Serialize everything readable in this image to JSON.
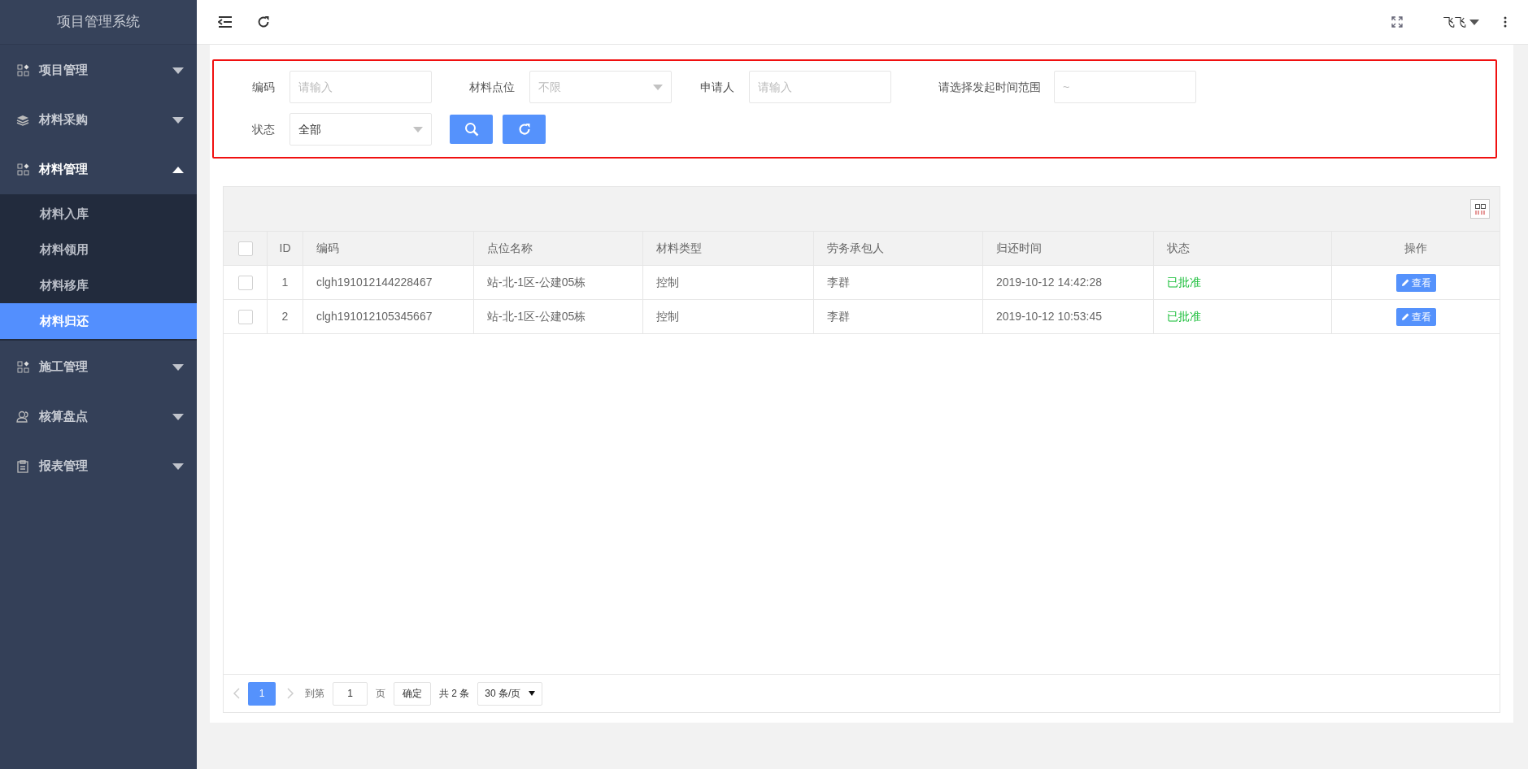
{
  "app_title": "项目管理系统",
  "sidebar": {
    "items": [
      {
        "label": "项目管理",
        "expanded": false
      },
      {
        "label": "材料采购",
        "expanded": false
      },
      {
        "label": "材料管理",
        "expanded": true,
        "children": [
          {
            "label": "材料入库",
            "selected": false
          },
          {
            "label": "材料领用",
            "selected": false
          },
          {
            "label": "材料移库",
            "selected": false
          },
          {
            "label": "材料归还",
            "selected": true
          }
        ]
      },
      {
        "label": "施工管理",
        "expanded": false
      },
      {
        "label": "核算盘点",
        "expanded": false
      },
      {
        "label": "报表管理",
        "expanded": false
      }
    ]
  },
  "user": {
    "name": "飞飞"
  },
  "filters": [
    {
      "kind": "input",
      "label": "编码",
      "placeholder": "请输入"
    },
    {
      "kind": "select",
      "label": "材料点位",
      "placeholder": "不限"
    },
    {
      "kind": "input",
      "label": "申请人",
      "placeholder": "请输入"
    },
    {
      "kind": "input",
      "label": "请选择发起时间范围",
      "placeholder": "~"
    },
    {
      "kind": "select",
      "label": "状态",
      "value": "全部"
    }
  ],
  "table": {
    "all_checked": false,
    "columns": [
      "ID",
      "编码",
      "点位名称",
      "材料类型",
      "劳务承包人",
      "归还时间",
      "状态",
      "操作"
    ],
    "rows": [
      {
        "checked": false,
        "cells": [
          "1",
          "clgh191012144228467",
          "站-北-1区-公建05栋",
          "控制",
          "李群",
          "2019-10-12 14:42:28",
          "已批准"
        ],
        "action": "查看"
      },
      {
        "checked": false,
        "cells": [
          "2",
          "clgh191012105345667",
          "站-北-1区-公建05栋",
          "控制",
          "李群",
          "2019-10-12 10:53:45",
          "已批准"
        ],
        "action": "查看"
      }
    ]
  },
  "pagination": {
    "pages": [
      {
        "label": "1",
        "selected": true
      }
    ],
    "goto_label": "到第",
    "goto_value": "1",
    "page_unit": "页",
    "confirm": "确定",
    "total": "共 2 条",
    "page_size": "30 条/页"
  }
}
